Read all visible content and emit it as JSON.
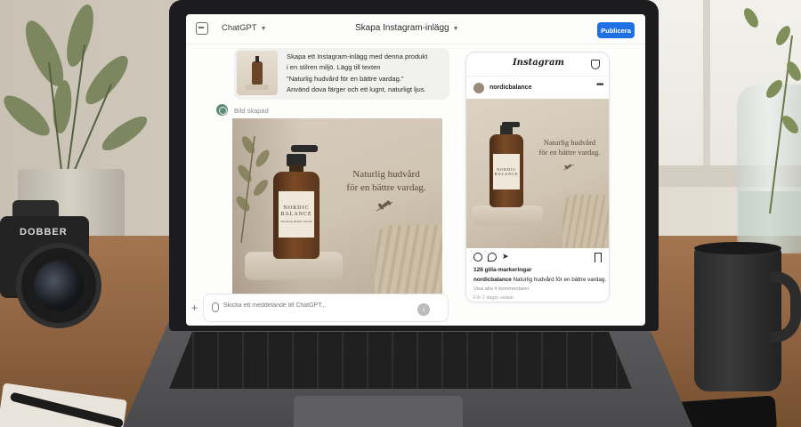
{
  "topbar": {
    "model": "ChatGPT",
    "title": "Skapa Instagram-inlägg",
    "publish_label": "Publicera"
  },
  "user_message": {
    "lines": [
      "Skapa ett Instagram-inlägg med denna produkt",
      "i en stilren miljö. Lägg till texten",
      "\"Naturlig hudvård för en bättre vardag.\"",
      "Använd dova färger och ett lugnt, naturligt ljus."
    ]
  },
  "assistant": {
    "status": "Bild skapad"
  },
  "generated_image": {
    "headline_1": "Naturlig hudvård",
    "headline_2": "för en bättre vardag.",
    "brand_1": "NORDIC",
    "brand_2": "BALANCE",
    "brand_sub": "HAND & BODY WASH"
  },
  "composer": {
    "placeholder": "Skicka ett meddelande till ChatGPT..."
  },
  "instagram": {
    "logo": "Instagram",
    "username": "nordicbalance",
    "likes": "128 gilla-markeringar",
    "caption_user": "nordicbalance",
    "caption_text": "Naturlig hudvård för en bättre vardag.",
    "view_comments": "Visa alla 4 kommentarer",
    "time": "För 2 dagar sedan"
  },
  "scene": {
    "camera_brand": "DOBBER"
  },
  "colors": {
    "accent": "#1f6fe5",
    "screen_bg": "#fdfdfc",
    "bottle_amber": "#6a4528"
  },
  "icons": {
    "sidebar_toggle": "sidebar-icon",
    "model_dropdown": "chevron-down-icon",
    "attach": "paperclip-icon",
    "send": "arrow-up-icon",
    "ig_like": "heart-icon",
    "ig_comment": "comment-icon",
    "ig_share": "send-icon",
    "ig_save": "bookmark-icon"
  }
}
